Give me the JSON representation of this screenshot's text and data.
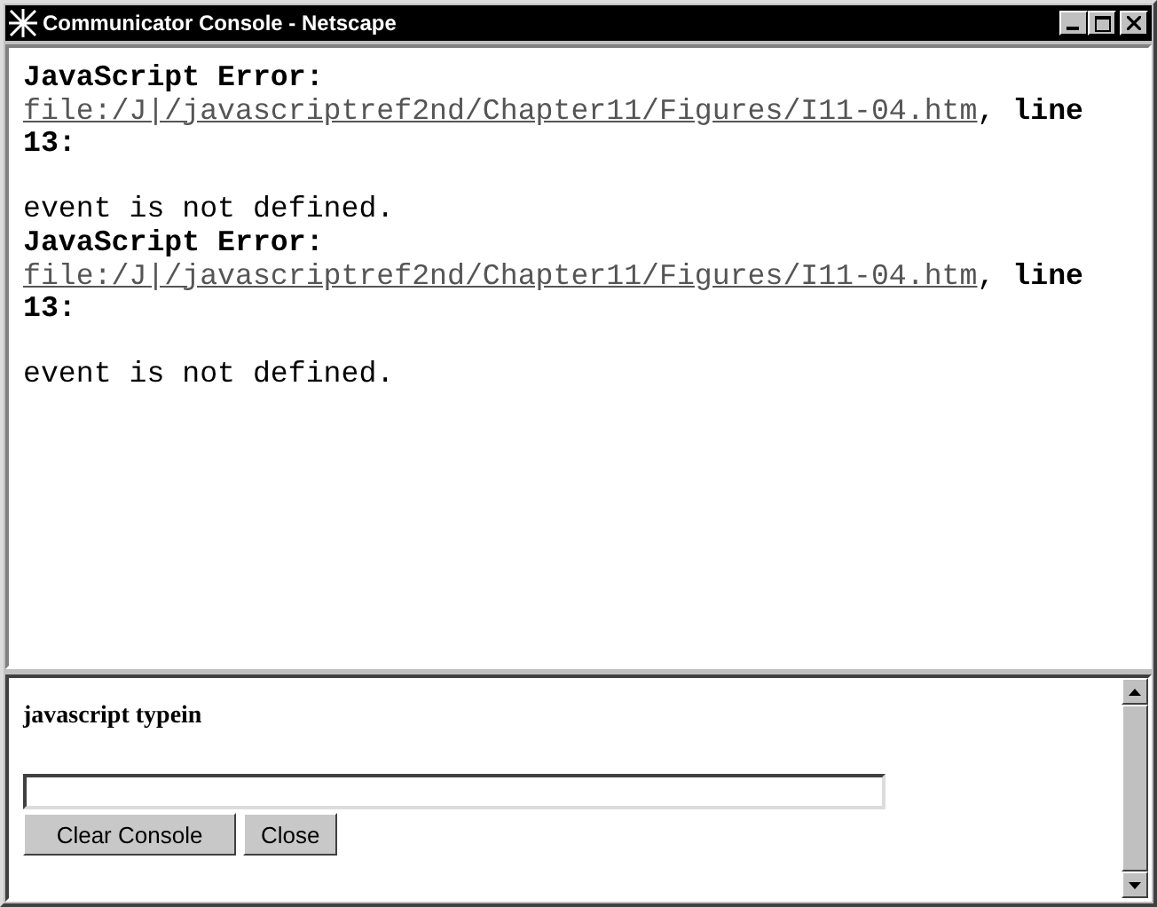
{
  "window": {
    "title": "Communicator Console - Netscape"
  },
  "errors": [
    {
      "label": "JavaScript Error:",
      "file": "file:/J|/javascriptref2nd/Chapter11/Figures/I11-04.htm",
      "line": ", **line**",
      "line_no": "13:",
      "message": "event is not defined."
    },
    {
      "label": "JavaScript Error:",
      "file": "file:/J|/javascriptref2nd/Chapter11/Figures/I11-04.htm",
      "line": ", **line**",
      "line_no": "13:",
      "message": "event is not defined."
    }
  ],
  "typein": {
    "label": "javascript typein"
  },
  "buttons": [
    "Clear Console",
    "Close"
  ]
}
